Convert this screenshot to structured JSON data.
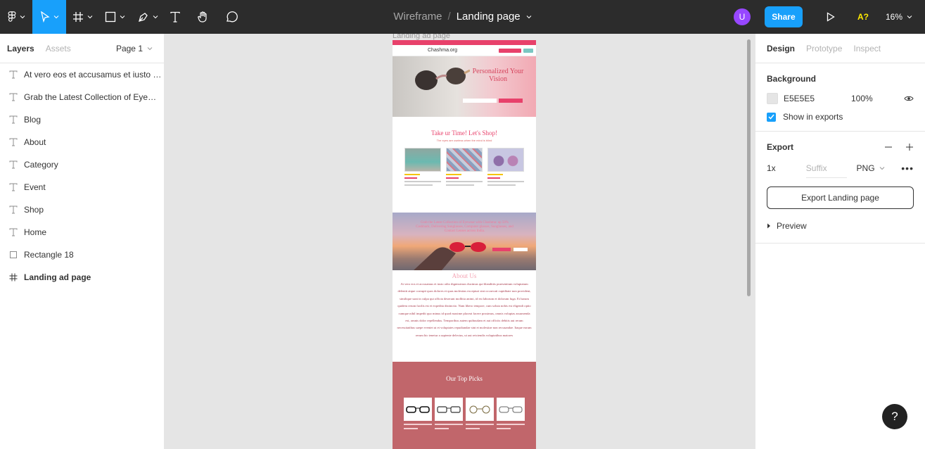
{
  "toolbar": {
    "project": "Wireframe",
    "separator": "/",
    "file_name": "Landing page",
    "avatar_initial": "U",
    "share_label": "Share",
    "a11y_label": "A?",
    "zoom": "16%"
  },
  "left_panel": {
    "tab_layers": "Layers",
    "tab_assets": "Assets",
    "page": "Page 1",
    "layers": [
      {
        "type": "text",
        "name": "At vero eos et accusamus et iusto odio dignissimos"
      },
      {
        "type": "text",
        "name": "Grab the Latest Collection of Eyewear with Chashma"
      },
      {
        "type": "text",
        "name": "Blog"
      },
      {
        "type": "text",
        "name": "About"
      },
      {
        "type": "text",
        "name": "Category"
      },
      {
        "type": "text",
        "name": "Event"
      },
      {
        "type": "text",
        "name": "Shop"
      },
      {
        "type": "text",
        "name": "Home"
      },
      {
        "type": "rect",
        "name": "Rectangle 18"
      },
      {
        "type": "frame",
        "name": "Landing ad page"
      }
    ]
  },
  "canvas": {
    "frame_label": "Landing ad page",
    "site": {
      "logo": "Chashma.org",
      "hero_title": "Personalized Your Vision",
      "shop_title": "Take ur Time! Let's Shop!",
      "shop_subtitle": "The eyes are useless when the mind is blind",
      "banner_text": "Grab the Latest Collection of Eyewear with Chashma: up 50% Cashback, Delivering Sunglasses, Computer glasses, Sunglasses, and Contact Lenses across India.",
      "about_title": "About Us",
      "about_body": "At vero eos et accusamus et iusto odio dignissimos ducimus qui blanditiis praesentium voluptatum deleniti atque corrupti quos dolores et quas molestias excepturi sint occaecati cupiditate non provident, similique sunt in culpa qui officia deserunt mollitia animi, id est laborum et dolorum fuga. Et harum quidem rerum facilis est et expedita distinctio. Nam libero tempore, cum soluta nobis est eligendi optio cumque nihil impedit quo minus id quod maxime placeat facere possimus, omnis voluptas assumenda est, omnis dolor repellendus. Temporibus autem quibusdam et aut officiis debitis aut rerum necessitatibus saepe eveniet ut et voluptates repudiandae sint et molestiae non recusandae. Itaque earum rerum hic tenetur a sapiente delectus, ut aut reiciendis voluptatibus maiores",
      "picks_title": "Our Top Picks"
    }
  },
  "right_panel": {
    "tab_design": "Design",
    "tab_prototype": "Prototype",
    "tab_inspect": "Inspect",
    "background_title": "Background",
    "bg_hex": "E5E5E5",
    "bg_opacity": "100%",
    "show_in_exports": "Show in exports",
    "export_title": "Export",
    "export_scale": "1x",
    "export_suffix_placeholder": "Suffix",
    "export_format": "PNG",
    "export_button": "Export Landing page",
    "preview_label": "Preview"
  },
  "help_label": "?",
  "colors": {
    "accent": "#18a0fb",
    "toolbar_bg": "#2c2c2c",
    "site_pink": "#e8416b",
    "site_rose": "#c1666b"
  }
}
